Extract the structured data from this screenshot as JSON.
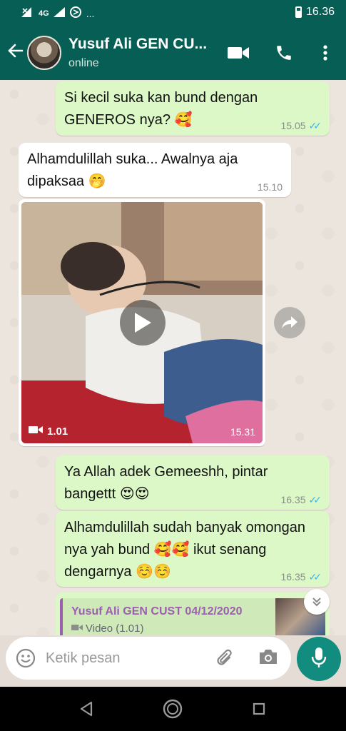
{
  "status_bar": {
    "time": "16.36",
    "network": "4G",
    "more": "..."
  },
  "header": {
    "title": "Yusuf Ali GEN CU...",
    "subtitle": "online"
  },
  "messages": [
    {
      "text": "Si kecil suka kan bund dengan GENEROS nya? 🥰",
      "time": "15.05",
      "outgoing": true
    },
    {
      "text": "Alhamdulillah suka...  Awalnya aja dipaksaa  🤭",
      "time": "15.10",
      "outgoing": false
    },
    {
      "type": "video",
      "duration": "1.01",
      "time": "15.31",
      "outgoing": false
    },
    {
      "text": "Ya Allah adek Gemeeshh, pintar bangettt 😍😍",
      "time": "16.35",
      "outgoing": true
    },
    {
      "text": "Alhamdulillah sudah banyak omongan nya yah bund 🥰🥰 ikut senang dengarnya ☺️☺️",
      "time": "16.35",
      "outgoing": true
    }
  ],
  "reply_preview": {
    "name": "Yusuf Ali GEN CUST 04/12/2020",
    "label": "Video (1.01)"
  },
  "input": {
    "placeholder": "Ketik pesan"
  },
  "colors": {
    "header": "#075e54",
    "outgoing_bubble": "#dcf8c6",
    "incoming_bubble": "#ffffff",
    "accent": "#128c7e",
    "read_ticks": "#34b7f1"
  }
}
